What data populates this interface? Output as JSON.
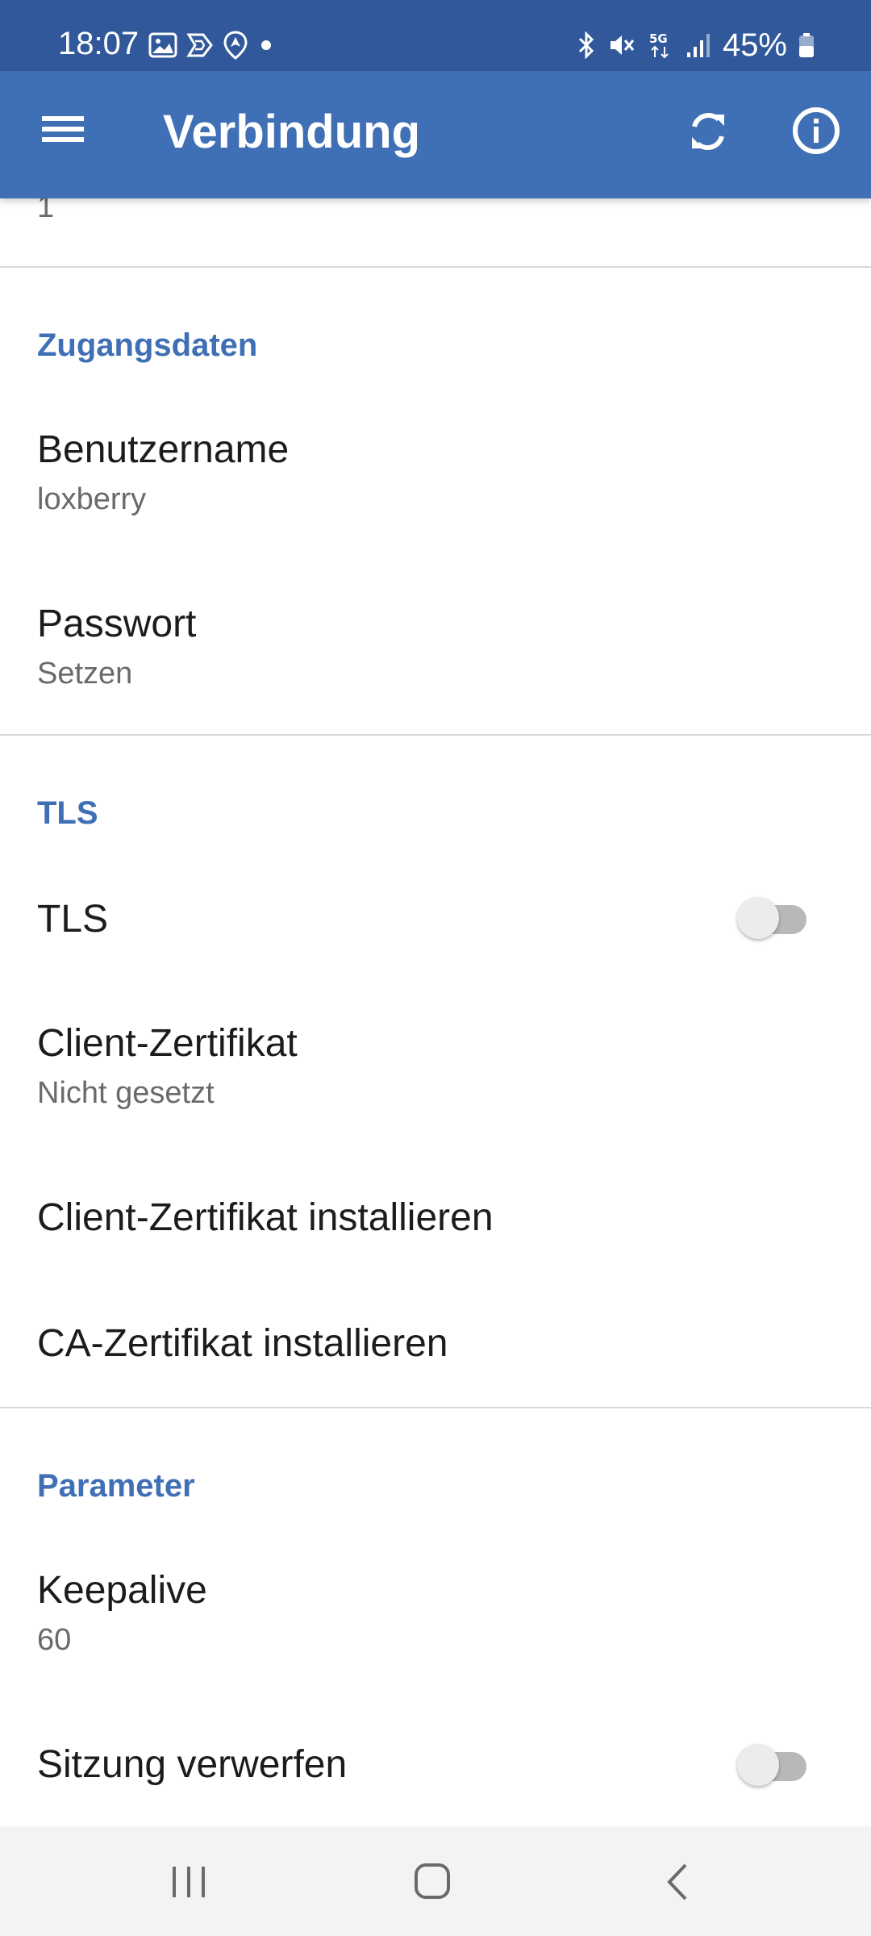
{
  "status_bar": {
    "time": "18:07",
    "battery": "45%",
    "left_icons": [
      "image-icon",
      "app-icon",
      "location-icon",
      "dot-icon"
    ],
    "right_icons": [
      "bluetooth-icon",
      "mute-icon",
      "5g-icon",
      "signal-icon",
      "battery-icon"
    ]
  },
  "app_bar": {
    "title": "Verbindung",
    "menu_icon": "menu-icon",
    "actions": [
      "sync-icon",
      "info-icon"
    ],
    "color": "#3f6fb5"
  },
  "prev_item_value": "1",
  "sections": {
    "credentials": {
      "header": "Zugangsdaten",
      "username": {
        "title": "Benutzername",
        "summary": "loxberry"
      },
      "password": {
        "title": "Passwort",
        "summary": "Setzen"
      }
    },
    "tls": {
      "header": "TLS",
      "tls_toggle": {
        "title": "TLS",
        "enabled": false
      },
      "client_cert": {
        "title": "Client-Zertifikat",
        "summary": "Nicht gesetzt"
      },
      "install_client_cert": {
        "title": "Client-Zertifikat installieren"
      },
      "install_ca_cert": {
        "title": "CA-Zertifikat installieren"
      }
    },
    "parameters": {
      "header": "Parameter",
      "keepalive": {
        "title": "Keepalive",
        "summary": "60"
      },
      "clean_session": {
        "title": "Sitzung verwerfen",
        "enabled": false
      }
    }
  },
  "nav_bar": {
    "buttons": [
      "recents-icon",
      "home-icon",
      "back-icon"
    ]
  }
}
